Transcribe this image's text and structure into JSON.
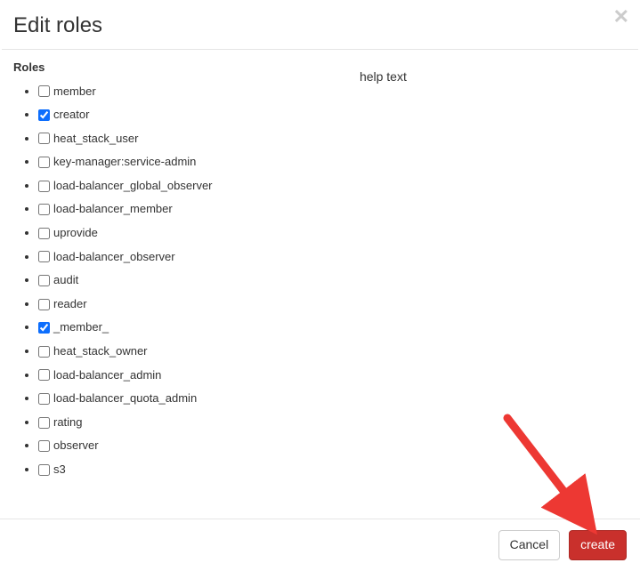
{
  "header": {
    "title": "Edit roles"
  },
  "section": {
    "label": "Roles"
  },
  "roles": [
    {
      "label": "member",
      "checked": false
    },
    {
      "label": "creator",
      "checked": true
    },
    {
      "label": "heat_stack_user",
      "checked": false
    },
    {
      "label": "key-manager:service-admin",
      "checked": false
    },
    {
      "label": "load-balancer_global_observer",
      "checked": false
    },
    {
      "label": "load-balancer_member",
      "checked": false
    },
    {
      "label": "uprovide",
      "checked": false
    },
    {
      "label": "load-balancer_observer",
      "checked": false
    },
    {
      "label": "audit",
      "checked": false
    },
    {
      "label": "reader",
      "checked": false
    },
    {
      "label": "_member_",
      "checked": true
    },
    {
      "label": "heat_stack_owner",
      "checked": false
    },
    {
      "label": "load-balancer_admin",
      "checked": false
    },
    {
      "label": "load-balancer_quota_admin",
      "checked": false
    },
    {
      "label": "rating",
      "checked": false
    },
    {
      "label": "observer",
      "checked": false
    },
    {
      "label": "s3",
      "checked": false
    }
  ],
  "help": {
    "text": "help text"
  },
  "footer": {
    "cancel": "Cancel",
    "create": "create"
  },
  "annotation": {
    "arrow_color": "#ed3833"
  }
}
